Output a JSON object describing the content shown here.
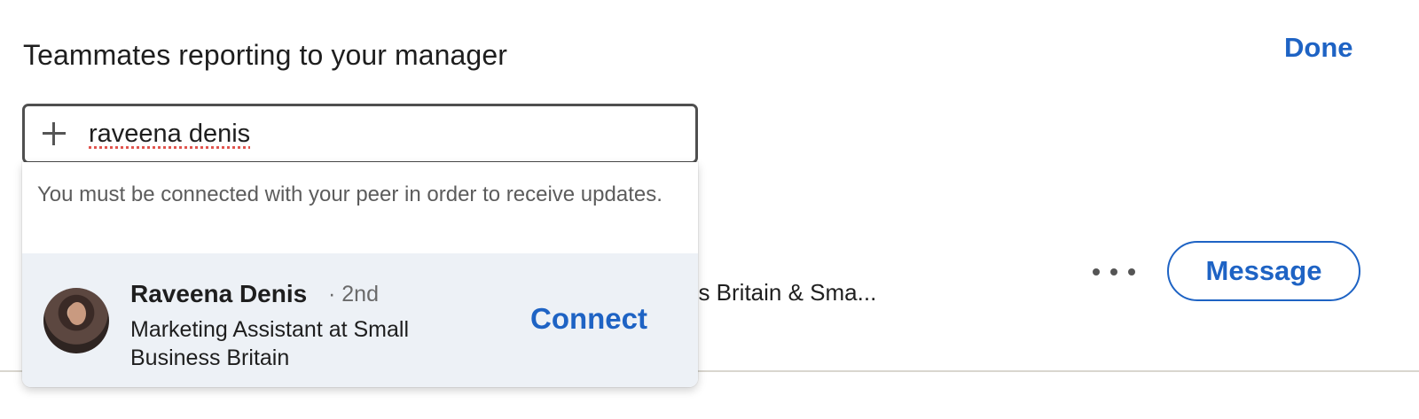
{
  "header": {
    "title": "Teammates reporting to your manager",
    "done_label": "Done"
  },
  "search": {
    "value": "raveena denis",
    "icon": "plus-icon"
  },
  "dropdown": {
    "notice": "You must be connected with your peer in order to receive updates.",
    "results": [
      {
        "name": "Raveena Denis",
        "degree": "· 2nd",
        "headline": "Marketing Assistant at Small Business Britain",
        "action_label": "Connect"
      }
    ]
  },
  "background_row": {
    "text_visible": "ess Britain & Sma...",
    "message_label": "Message",
    "more_icon": "more-horizontal-icon"
  },
  "colors": {
    "accent": "#1e63c4",
    "result_highlight": "#edf1f6"
  }
}
